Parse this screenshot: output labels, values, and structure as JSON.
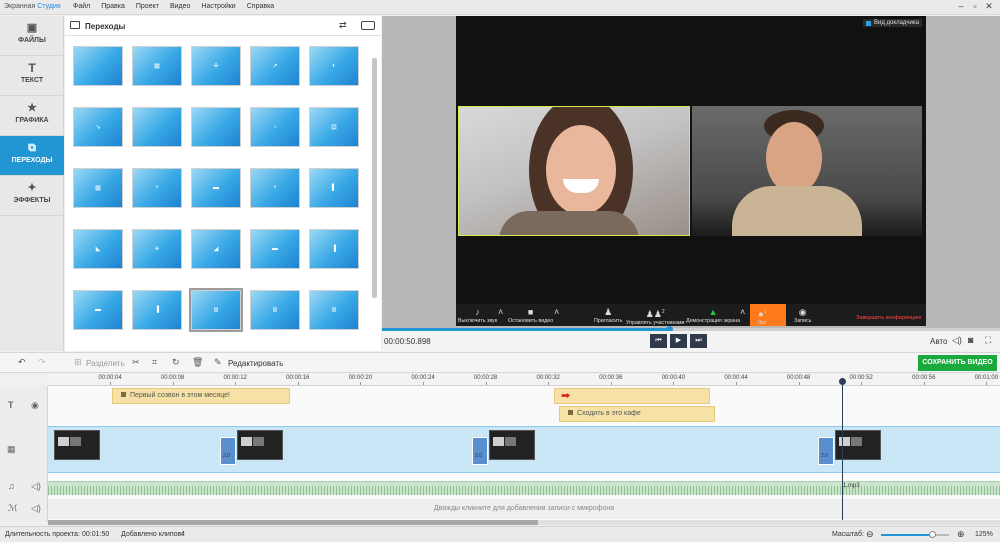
{
  "app": {
    "brand_part1": "Экранная ",
    "brand_part2": "Студия"
  },
  "menu": [
    "Файл",
    "Правка",
    "Проект",
    "Видео",
    "Настройки",
    "Справка"
  ],
  "side_tabs": [
    {
      "label": "ФАЙЛЫ",
      "icon": "image-icon"
    },
    {
      "label": "ТЕКСТ",
      "icon": "text-icon"
    },
    {
      "label": "ГРАФИКА",
      "icon": "star-icon"
    },
    {
      "label": "ПЕРЕХОДЫ",
      "icon": "transition-icon",
      "active": true
    },
    {
      "label": "ЭФФЕКТЫ",
      "icon": "magic-wand-icon"
    }
  ],
  "panel": {
    "title": "Переходы"
  },
  "preview": {
    "view_mode": "Вид докладчика",
    "zoom_bar": {
      "mute": "Выключить звук",
      "stop_video": "Остановить видео",
      "invite": "Пригласить",
      "manage_participants": "Управлять участниками",
      "participants_count": "2",
      "share_screen": "Демонстрация экрана",
      "chat": "Чат",
      "chat_count": "1",
      "record": "Запись",
      "end_conference": "Завершить конференцию"
    },
    "time": "00:00:50.898",
    "auto_label": "Авто",
    "progress_fraction": 0.465
  },
  "toolbar": {
    "split": "Разделить",
    "edit": "Редактировать",
    "save": "СОХРАНИТЬ ВИДЕО"
  },
  "ruler": [
    "00:00:04",
    "00:00:08",
    "00:00:12",
    "00:00:16",
    "00:00:20",
    "00:00:24",
    "00:00:28",
    "00:00:32",
    "00:00:36",
    "00:00:40",
    "00:00:44",
    "00:00:48",
    "00:00:52",
    "00:00:56",
    "00:01:00"
  ],
  "captions": {
    "first": "Первый созвон в этом месяце!",
    "second": "Сходить в это кафе"
  },
  "clips": {
    "transition_duration": "2.0"
  },
  "audio": {
    "file_name": "1.mp3"
  },
  "mic": {
    "hint": "Дважды кликните для добавления записи с микрофона"
  },
  "status": {
    "duration_label": "Длительность проекта:",
    "duration_value": "00:01:50",
    "clips_label": "Добавлено клипов:",
    "clips_value": "4",
    "zoom_label": "Масштаб:",
    "zoom_value": "125%"
  },
  "colors": {
    "accent": "#2196d3",
    "save_button": "#1aa93c",
    "caption": "#f6e1a6",
    "video_track": "#c9e6f7",
    "audio_track": "#cde5cf"
  }
}
